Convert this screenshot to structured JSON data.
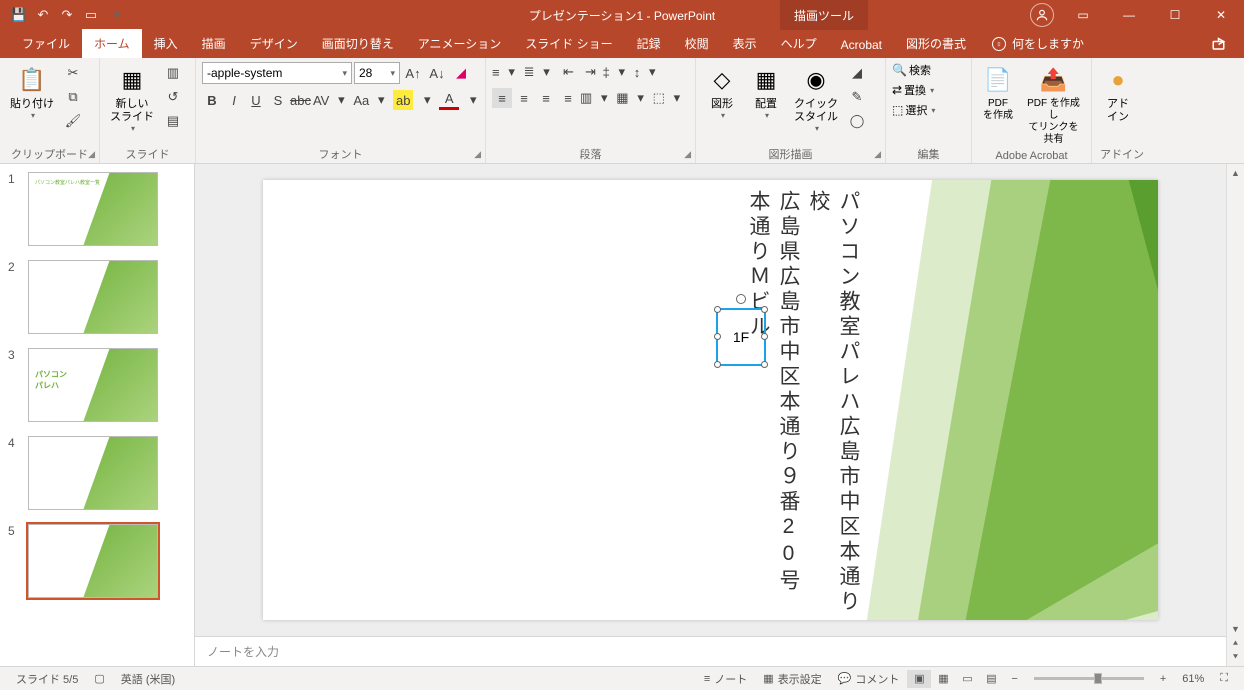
{
  "title": "プレゼンテーション1 - PowerPoint",
  "context_tab": "描画ツール",
  "tabs": {
    "file": "ファイル",
    "home": "ホーム",
    "insert": "挿入",
    "draw": "描画",
    "design": "デザイン",
    "transitions": "画面切り替え",
    "animations": "アニメーション",
    "slideshow": "スライド ショー",
    "record": "記録",
    "review": "校閲",
    "view": "表示",
    "help": "ヘルプ",
    "acrobat": "Acrobat",
    "format": "図形の書式",
    "tellme": "何をしますか"
  },
  "ribbon": {
    "clipboard": {
      "paste": "貼り付け",
      "label": "クリップボード"
    },
    "slides": {
      "new": "新しい\nスライド",
      "label": "スライド"
    },
    "font": {
      "name": "-apple-system",
      "size": "28",
      "label": "フォント"
    },
    "paragraph": {
      "label": "段落"
    },
    "drawing": {
      "shapes": "図形",
      "arrange": "配置",
      "quick": "クイック\nスタイル",
      "label": "図形描画"
    },
    "editing": {
      "find": "検索",
      "replace": "置換",
      "select": "選択",
      "label": "編集"
    },
    "acrobat": {
      "create": "PDF\nを作成",
      "share": "PDF を作成し\nてリンクを共有",
      "label": "Adobe Acrobat"
    },
    "addin": {
      "btn": "アド\nイン",
      "label": "アドイン"
    }
  },
  "slide_content": {
    "line1": "パソコン教室パレハ広島市中区本通り校",
    "line2": "広島県広島市中区本通り９番20号",
    "line3": "本通りＭビル",
    "sel": "1F"
  },
  "notes_placeholder": "ノートを入力",
  "status": {
    "slide": "スライド 5/5",
    "lang": "英語 (米国)",
    "notes": "ノート",
    "display": "表示設定",
    "comments": "コメント",
    "zoom": "61%"
  },
  "thumbs": [
    "1",
    "2",
    "3",
    "4",
    "5"
  ]
}
